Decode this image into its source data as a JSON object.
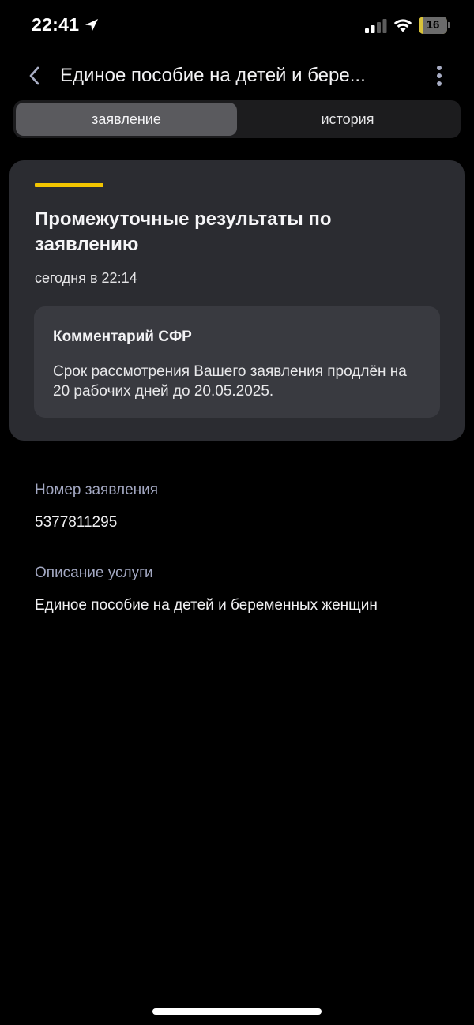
{
  "status_bar": {
    "time": "22:41",
    "battery_level": "16",
    "battery_fraction": 0.16
  },
  "header": {
    "title": "Единое пособие на детей и бере..."
  },
  "tabs": [
    {
      "label": "заявление",
      "active": true
    },
    {
      "label": "история",
      "active": false
    }
  ],
  "card": {
    "accent_color": "#f2c500",
    "title": "Промежуточные результаты по заявлению",
    "time": "сегодня в 22:14",
    "comment": {
      "title": "Комментарий СФР",
      "text": "Срок рассмотрения Вашего заявления продлён на 20 рабочих дней до 20.05.2025."
    }
  },
  "fields": [
    {
      "label": "Номер заявления",
      "value": "5377811295"
    },
    {
      "label": "Описание услуги",
      "value": "Единое пособие на детей и беременных женщин"
    }
  ],
  "icons": {
    "back": "chevron-left-icon",
    "more": "more-vertical-icon",
    "location": "location-arrow-icon",
    "signal": "cellular-signal-icon",
    "wifi": "wifi-icon",
    "battery": "battery-icon"
  }
}
